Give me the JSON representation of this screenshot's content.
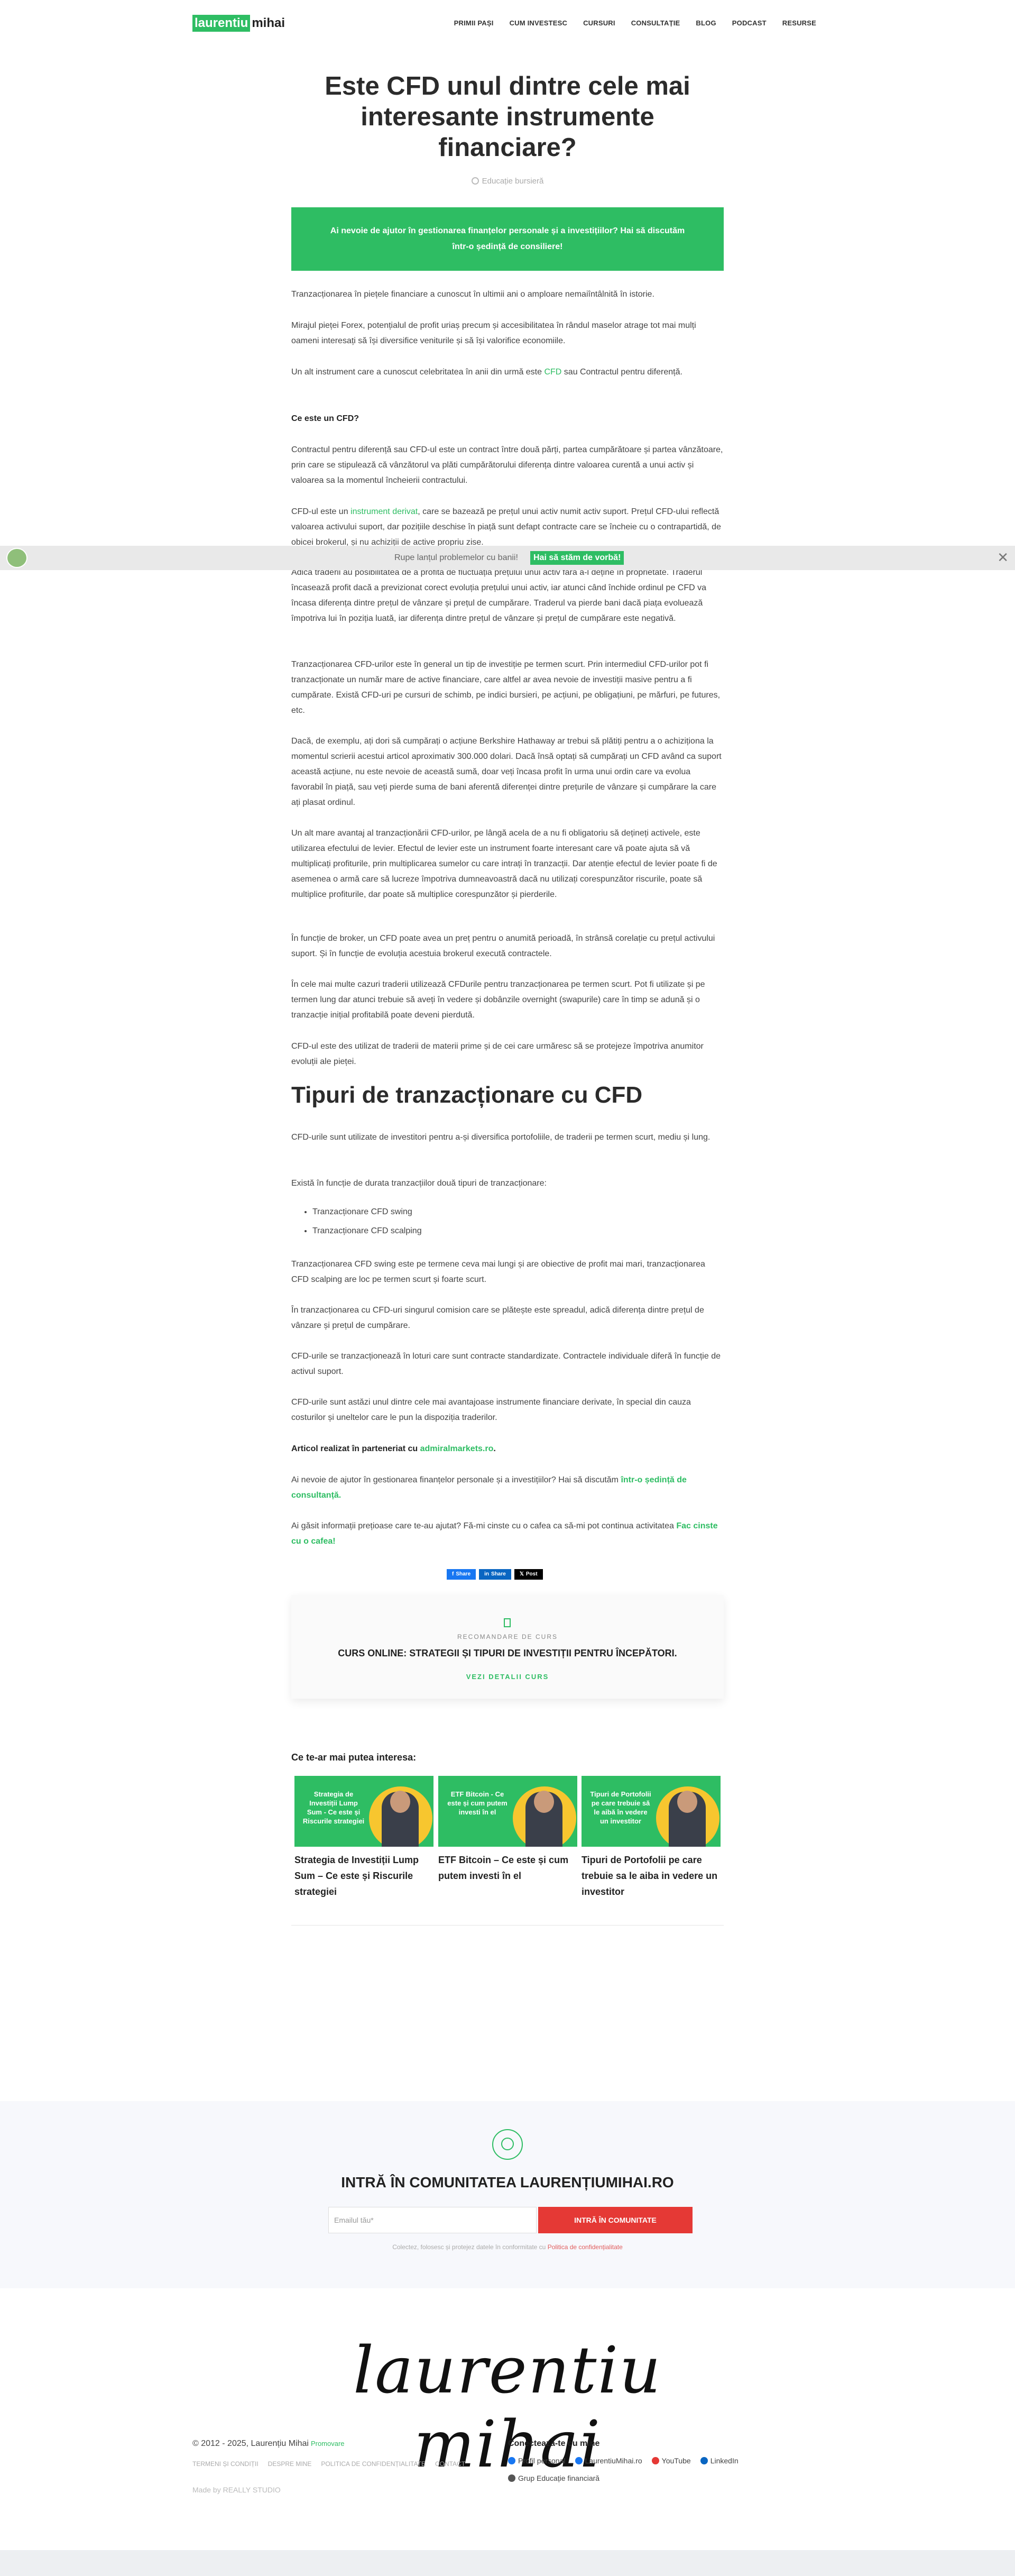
{
  "header": {
    "logo_green": "laurentiu",
    "logo_dark": "mihai",
    "nav": [
      "PRIMII PAȘI",
      "CUM INVESTESC",
      "CURSURI",
      "CONSULTAȚIE",
      "BLOG",
      "PODCAST",
      "RESURSE"
    ]
  },
  "article": {
    "title": "Este CFD unul dintre cele mai interesante instrumente financiare?",
    "category": "Educație bursieră",
    "cta": "Ai nevoie de ajutor în gestionarea finanțelor personale și a investițiilor? Hai să discutăm într-o ședință de consiliere!",
    "paragraphs": [
      "Tranzacționarea în piețele financiare a cunoscut în ultimii ani o amploare nemaiîntâlnită în istorie.",
      "Mirajul pieței Forex, potențialul de profit uriaș precum și accesibilitatea în rândul maselor atrage tot mai mulți oameni interesați să își diversifice veniturile și să își valorifice economiile.",
      "Un alt instrument care a cunoscut celebritatea în anii din urmă este ",
      "Ce este un CFD?",
      "Contractul pentru diferență sau CFD-ul este un contract între două părți, partea cumpărătoare și partea vânzătoare, prin care se stipulează că vânzătorul va plăti cumpărătorului diferența dintre valoarea curentă a unui activ și valoarea sa la momentul încheierii contractului.",
      "CFD-ul este un ",
      "Adică traderii au posibilitatea de a profita de fluctuația prețului unui activ fără a-l deține în proprietate. Traderul încasează profit dacă a previzionat corect evoluția prețului unui activ, iar atunci când închide ordinul pe CFD va încasa diferența dintre prețul de vânzare și prețul de cumpărare. Traderul va pierde bani dacă piața evoluează împotriva lui în poziția luată, iar diferența dintre prețul de vânzare și prețul de cumpărare este negativă.",
      "Tranzacționarea CFD-urilor este în general un tip de investiție pe termen scurt. Prin intermediul CFD-urilor pot fi tranzacționate un număr mare de active financiare, care altfel ar avea nevoie de investiții masive pentru a fi cumpărate.  Există CFD-uri pe cursuri de schimb, pe indici bursieri, pe acțiuni, pe obligațiuni, pe mărfuri, pe futures, etc.",
      "Dacă, de exemplu, ați dori să cumpărați o acțiune Berkshire Hathaway ar trebui să plătiți pentru a o achiziționa la momentul scrierii acestui articol aproximativ 300.000 dolari. Dacă însă optați să cumpărați un CFD având ca suport această acțiune, nu este nevoie de această sumă, doar veți încasa profit în urma unui ordin care va evolua favorabil în piață, sau veți pierde suma de bani aferentă diferenței dintre prețurile de vânzare și cumpărare la care ați plasat ordinul.",
      "Un alt mare avantaj al tranzacționării CFD-urilor, pe lângă acela de a nu fi obligatoriu să dețineți activele, este utilizarea efectului de levier.  Efectul de levier este un instrument foarte interesant care vă poate ajuta să vă multiplicați profiturile, prin multiplicarea sumelor cu care intrați în tranzacții. Dar atenție efectul de levier poate fi de asemenea o armă care să lucreze împotriva dumneavoastră dacă nu utilizați corespunzător riscurile, poate să multiplice profiturile, dar poate să multiplice corespunzător și pierderile.",
      "În funcție de broker, un CFD poate avea un preț pentru o anumită perioadă, în strânsă corelație cu prețul activului suport. Și în funcție de evoluția acestuia brokerul execută contractele.",
      "În cele mai multe cazuri traderii utilizează CFDurile pentru tranzacționarea pe termen scurt. Pot fi utilizate și pe termen lung dar atunci trebuie să aveți în vedere și dobânzile overnight (swapurile) care în timp se adună și o tranzacție inițial profitabilă poate deveni pierdută.",
      "CFD-ul este des utilizat de traderii de materii prime și de cei care urmăresc să se protejeze împotriva anumitor evoluții ale pieței."
    ],
    "cfd_link": "CFD",
    "cfd_after": " sau Contractul pentru diferență.",
    "derivat_link": "instrument derivat",
    "derivat_after": ", care se bazează pe prețul unui activ numit activ suport. Prețul CFD-ului reflectă valoarea activului suport, dar pozițiile deschise în piață sunt defapt contracte care se încheie cu o contrapartidă, de obicei brokerul, și nu achiziții de active propriu zise.",
    "h2": "Tipuri de tranzacționare cu CFD",
    "paragraphs2": [
      "CFD-urile sunt utilizate de investitori pentru a-și diversifica portofoliile, de traderii pe termen scurt, mediu și lung.",
      "Există în funcție de durata tranzacțiilor două tipuri de tranzacționare:",
      "Tranzacționarea CFD swing este pe termene ceva mai lungi și are obiective de profit mai mari, tranzacționarea CFD scalping are loc pe termen scurt și foarte scurt.",
      "În tranzacționarea cu CFD-uri singurul comision care se plătește este spreadul, adică diferența dintre prețul de vânzare și prețul de cumpărare.",
      "CFD-urile se tranzacționează în loturi care sunt contracte standardizate. Contractele individuale diferă în funcție de activul suport.",
      "CFD-urile sunt astăzi unul dintre cele mai avantajoase instrumente financiare derivate, în special din cauza costurilor și uneltelor care le pun la dispoziția traderilor."
    ],
    "list": [
      "Tranzacționare CFD swing",
      "Tranzacționare CFD scalping"
    ],
    "partner_prefix": "Articol realizat în parteneriat cu ",
    "partner_link": "admiralmarkets.ro",
    "partner_suffix": ".",
    "help_text": "Ai nevoie de ajutor în gestionarea finanțelor personale și a investițiilor? Hai să discutăm ",
    "help_link": "într-o ședință de consultanță.",
    "coffee_text": "Ai găsit informații prețioase care te-au ajutat? Fă-mi cinste cu o cafea ca să-mi pot continua activitatea ",
    "coffee_link": "Fac cinste cu o cafea!"
  },
  "sticky": {
    "text": "Rupe lanțul problemelor cu banii!",
    "button": "Hai să stăm de vorbă!",
    "close": "✕"
  },
  "share": {
    "facebook": "Share",
    "linkedin": "Share",
    "x": "Post"
  },
  "course": {
    "label": "RECOMANDARE DE CURS",
    "name": "CURS ONLINE: STRATEGII ȘI TIPURI DE INVESTIȚII PENTRU ÎNCEPĂTORI.",
    "link": "VEZI DETALII CURS"
  },
  "related": {
    "heading": "Ce te-ar mai putea interesa:",
    "items": [
      {
        "image_text": "Strategia de Investiții Lump Sum - Ce este și Riscurile strategiei",
        "title": "Strategia de Investiții Lump Sum – Ce este și Riscurile strategiei"
      },
      {
        "image_text": "ETF Bitcoin - Ce este și cum putem investi în el",
        "title": "ETF Bitcoin – Ce este și cum putem investi în el"
      },
      {
        "image_text": "Tipuri de Portofolii pe care trebuie să le aibă în vedere un investitor",
        "title": "Tipuri de Portofolii pe care trebuie sa le aiba in vedere un investitor"
      }
    ]
  },
  "community": {
    "title": "INTRĂ ÎN COMUNITATEA LAURENȚIUMIHAI.RO",
    "placeholder": "Emailul tău*",
    "button": "INTRĂ ÎN COMUNITATE",
    "note": "Colectez, folosesc și protejez datele în conformitate cu ",
    "note_link": "Politica de confidențialitate"
  },
  "footer": {
    "signature": "laurentiu mihai",
    "copyright": "© 2012 - 2025, Laurențiu Mihai",
    "copyright_link": "Promovare",
    "links": [
      "TERMENI ȘI CONDIȚII",
      "DESPRE MINE",
      "POLITICA DE CONFIDENȚIALITATE",
      "CONTACT"
    ],
    "madeby": "Made by REALLY STUDIO",
    "connect_title": "Conectează-te cu mine",
    "connect_row1": [
      "Profil personal",
      "LaurentiuMihai.ro",
      "YouTube",
      "LinkedIn"
    ],
    "connect_row2": [
      "Grup Educație financiară"
    ],
    "colors": {
      "accent": "#2ebd63",
      "red": "#e53935"
    }
  }
}
